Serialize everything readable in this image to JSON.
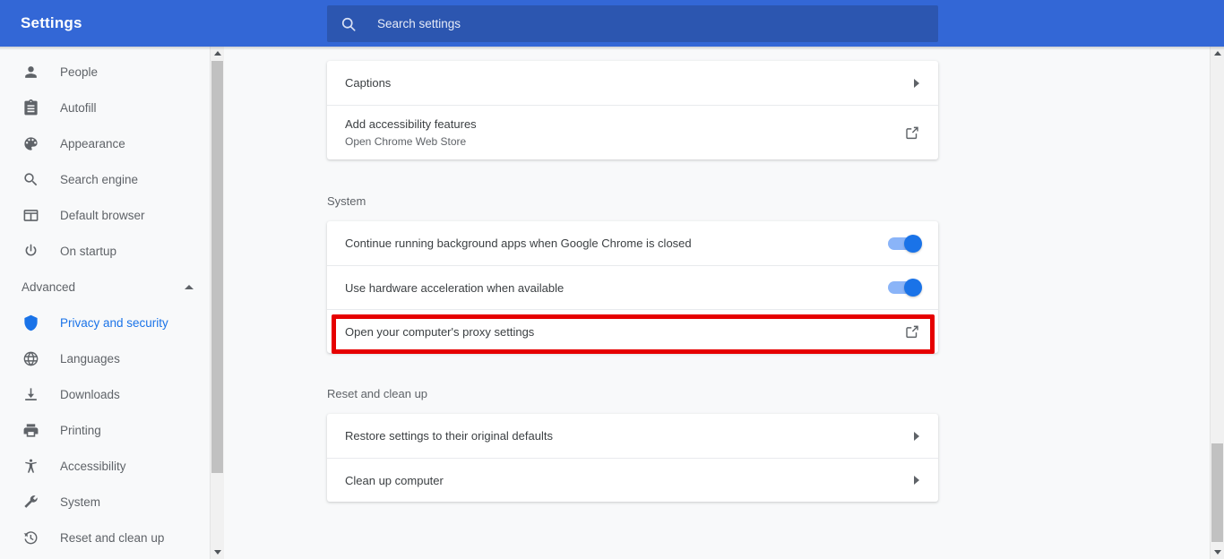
{
  "header": {
    "title": "Settings",
    "search_icon": "search-icon",
    "search_placeholder": "Search settings",
    "search_value": "",
    "background_color": "#3367d6",
    "search_background_color": "#2c56b0"
  },
  "sidebar": {
    "items": [
      {
        "label": "People",
        "icon": "person-icon",
        "selected": false
      },
      {
        "label": "Autofill",
        "icon": "clipboard-icon",
        "selected": false
      },
      {
        "label": "Appearance",
        "icon": "palette-icon",
        "selected": false
      },
      {
        "label": "Search engine",
        "icon": "search-icon",
        "selected": false
      },
      {
        "label": "Default browser",
        "icon": "browser-icon",
        "selected": false
      },
      {
        "label": "On startup",
        "icon": "power-icon",
        "selected": false
      }
    ],
    "advanced": {
      "label": "Advanced",
      "expanded": true,
      "chevron_icon": "chevron-up-icon"
    },
    "advanced_items": [
      {
        "label": "Privacy and security",
        "icon": "shield-icon",
        "selected": true
      },
      {
        "label": "Languages",
        "icon": "globe-icon",
        "selected": false
      },
      {
        "label": "Downloads",
        "icon": "download-icon",
        "selected": false
      },
      {
        "label": "Printing",
        "icon": "printer-icon",
        "selected": false
      },
      {
        "label": "Accessibility",
        "icon": "accessibility-icon",
        "selected": false
      },
      {
        "label": "System",
        "icon": "wrench-icon",
        "selected": false
      },
      {
        "label": "Reset and clean up",
        "icon": "history-icon",
        "selected": false
      }
    ],
    "selected_color": "#1a73e8",
    "text_color": "#5f6368"
  },
  "main": {
    "accessibility_card": {
      "rows": [
        {
          "title": "Captions",
          "sub": "",
          "control": "chevron-right-icon"
        },
        {
          "title": "Add accessibility features",
          "sub": "Open Chrome Web Store",
          "control": "external-link-icon"
        }
      ]
    },
    "system_section": {
      "title": "System",
      "rows": [
        {
          "title": "Continue running background apps when Google Chrome is closed",
          "sub": "",
          "control": "toggle",
          "toggle_on": true
        },
        {
          "title": "Use hardware acceleration when available",
          "sub": "",
          "control": "toggle",
          "toggle_on": true
        },
        {
          "title": "Open your computer's proxy settings",
          "sub": "",
          "control": "external-link-icon",
          "highlighted": true
        }
      ]
    },
    "reset_section": {
      "title": "Reset and clean up",
      "rows": [
        {
          "title": "Restore settings to their original defaults",
          "sub": "",
          "control": "chevron-right-icon"
        },
        {
          "title": "Clean up computer",
          "sub": "",
          "control": "chevron-right-icon"
        }
      ]
    },
    "highlight_color": "#e60000",
    "toggle_track_color": "#8ab4f8",
    "toggle_knob_color": "#1a73e8",
    "card_background": "#ffffff",
    "page_background": "#f8f9fa"
  },
  "scrollbars": {
    "sidebar": {
      "up_icon": "triangle-up-icon",
      "down_icon": "triangle-down-icon"
    },
    "page": {
      "up_icon": "triangle-up-icon",
      "down_icon": "triangle-down-icon"
    }
  }
}
